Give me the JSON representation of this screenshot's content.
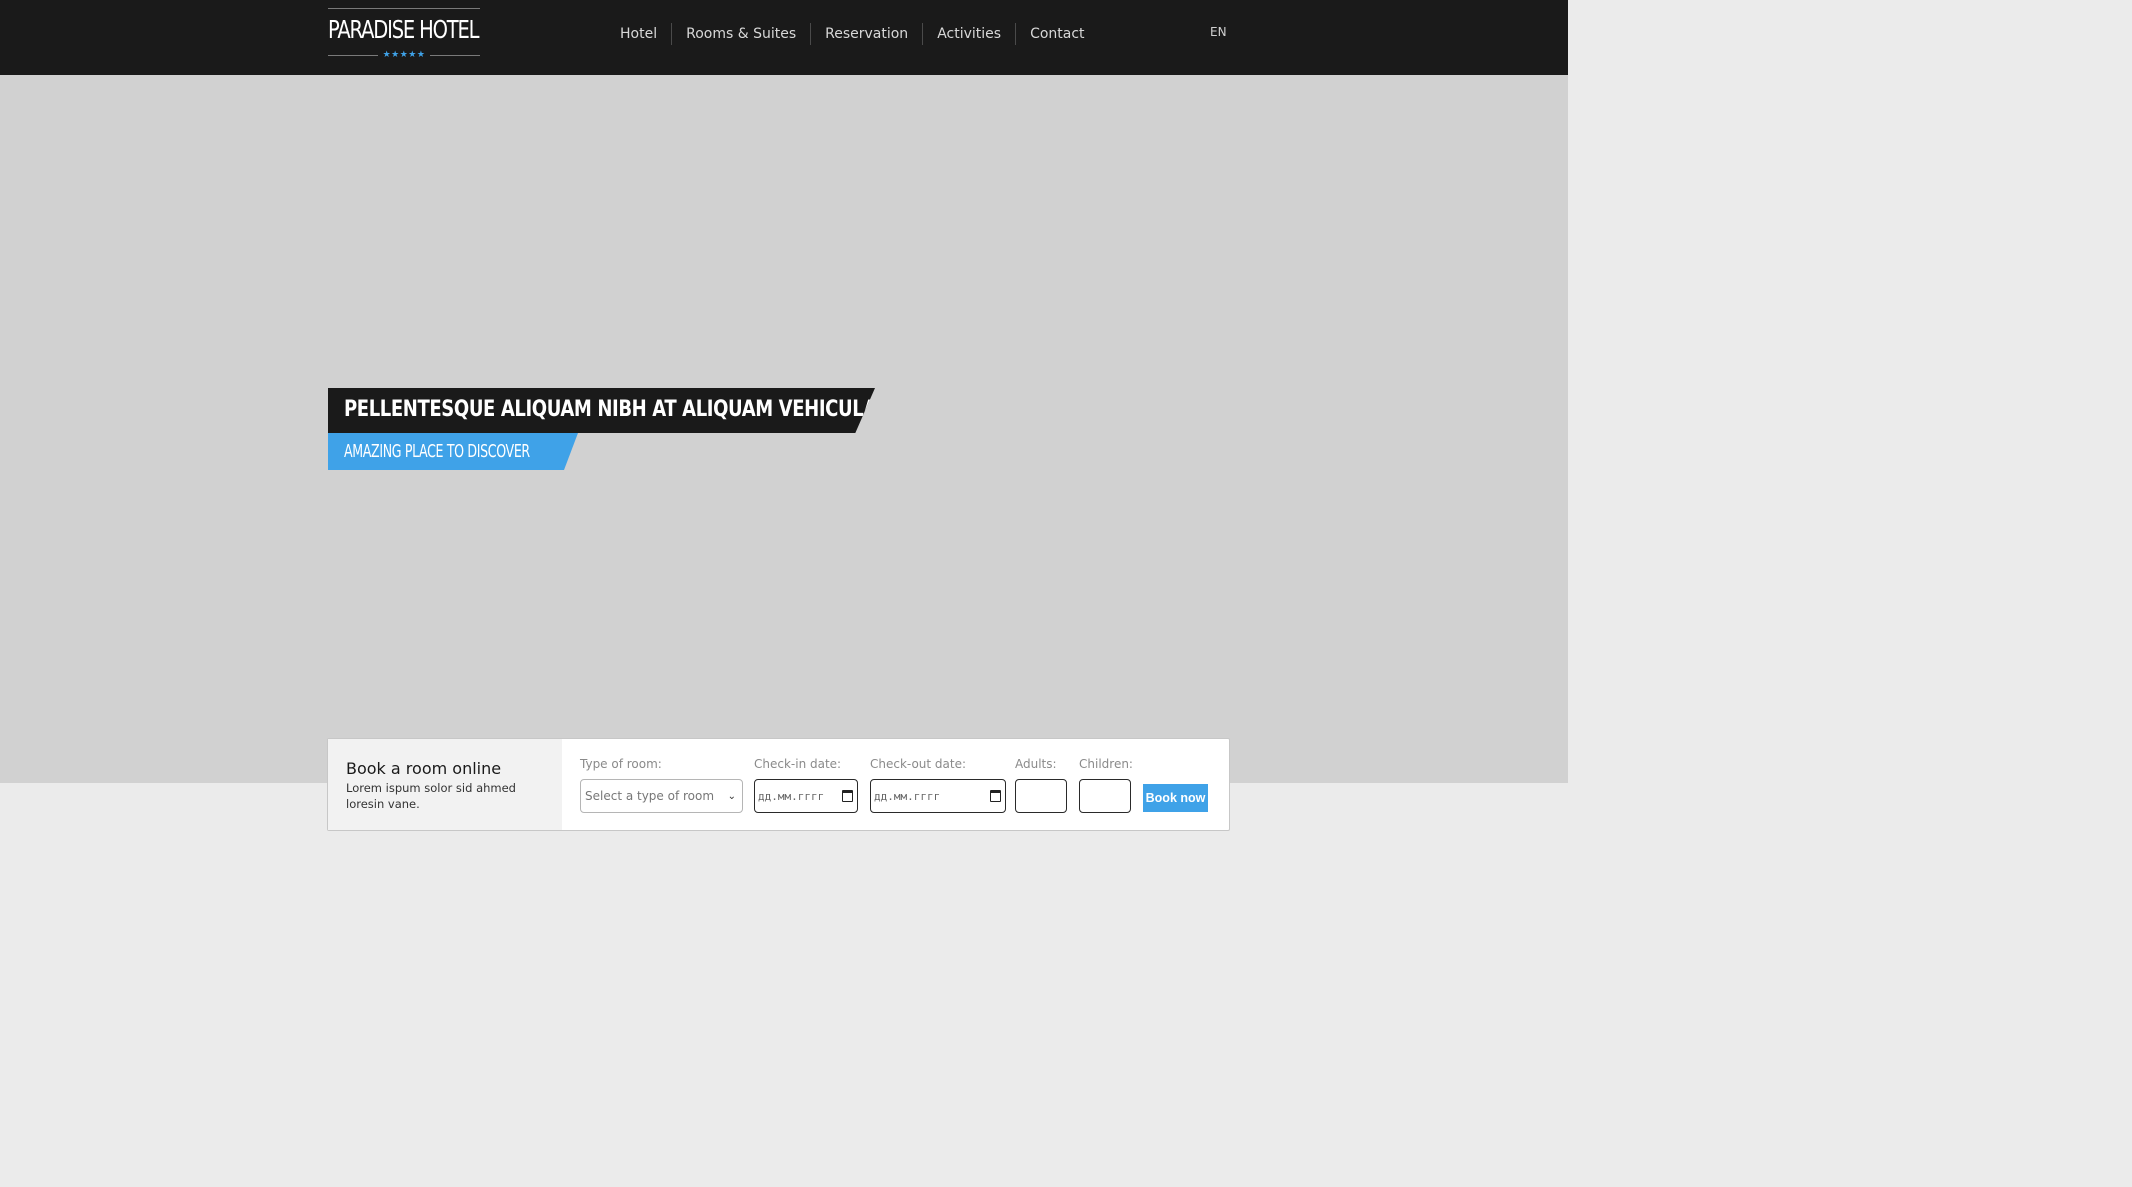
{
  "header": {
    "brand": "PARADISE HOTEL",
    "stars": "★★★★★",
    "nav": [
      {
        "label": "Hotel"
      },
      {
        "label": "Rooms & Suites"
      },
      {
        "label": "Reservation"
      },
      {
        "label": "Activities"
      },
      {
        "label": "Contact"
      }
    ],
    "language": "EN"
  },
  "hero": {
    "headline": "PELLENTESQUE ALIQUAM NIBH AT ALIQUAM VEHICULA",
    "subheadline": "AMAZING PLACE TO DISCOVER"
  },
  "booking": {
    "title": "Book a room online",
    "description": "Lorem ispum solor sid ahmed loresin vane.",
    "room_type": {
      "label": "Type of room:",
      "value": "Select a type of room"
    },
    "checkin": {
      "label": "Check-in date:",
      "placeholder": "дд.мм.гггг"
    },
    "checkout": {
      "label": "Check-out date:",
      "placeholder": "дд.мм.гггг"
    },
    "adults": {
      "label": "Adults:",
      "value": ""
    },
    "children": {
      "label": "Children:",
      "value": ""
    },
    "submit_label": "Book now"
  },
  "colors": {
    "accent": "#3fa2e8",
    "header_bg": "#1a1a1a",
    "hero_bg": "#d1d1d1"
  }
}
